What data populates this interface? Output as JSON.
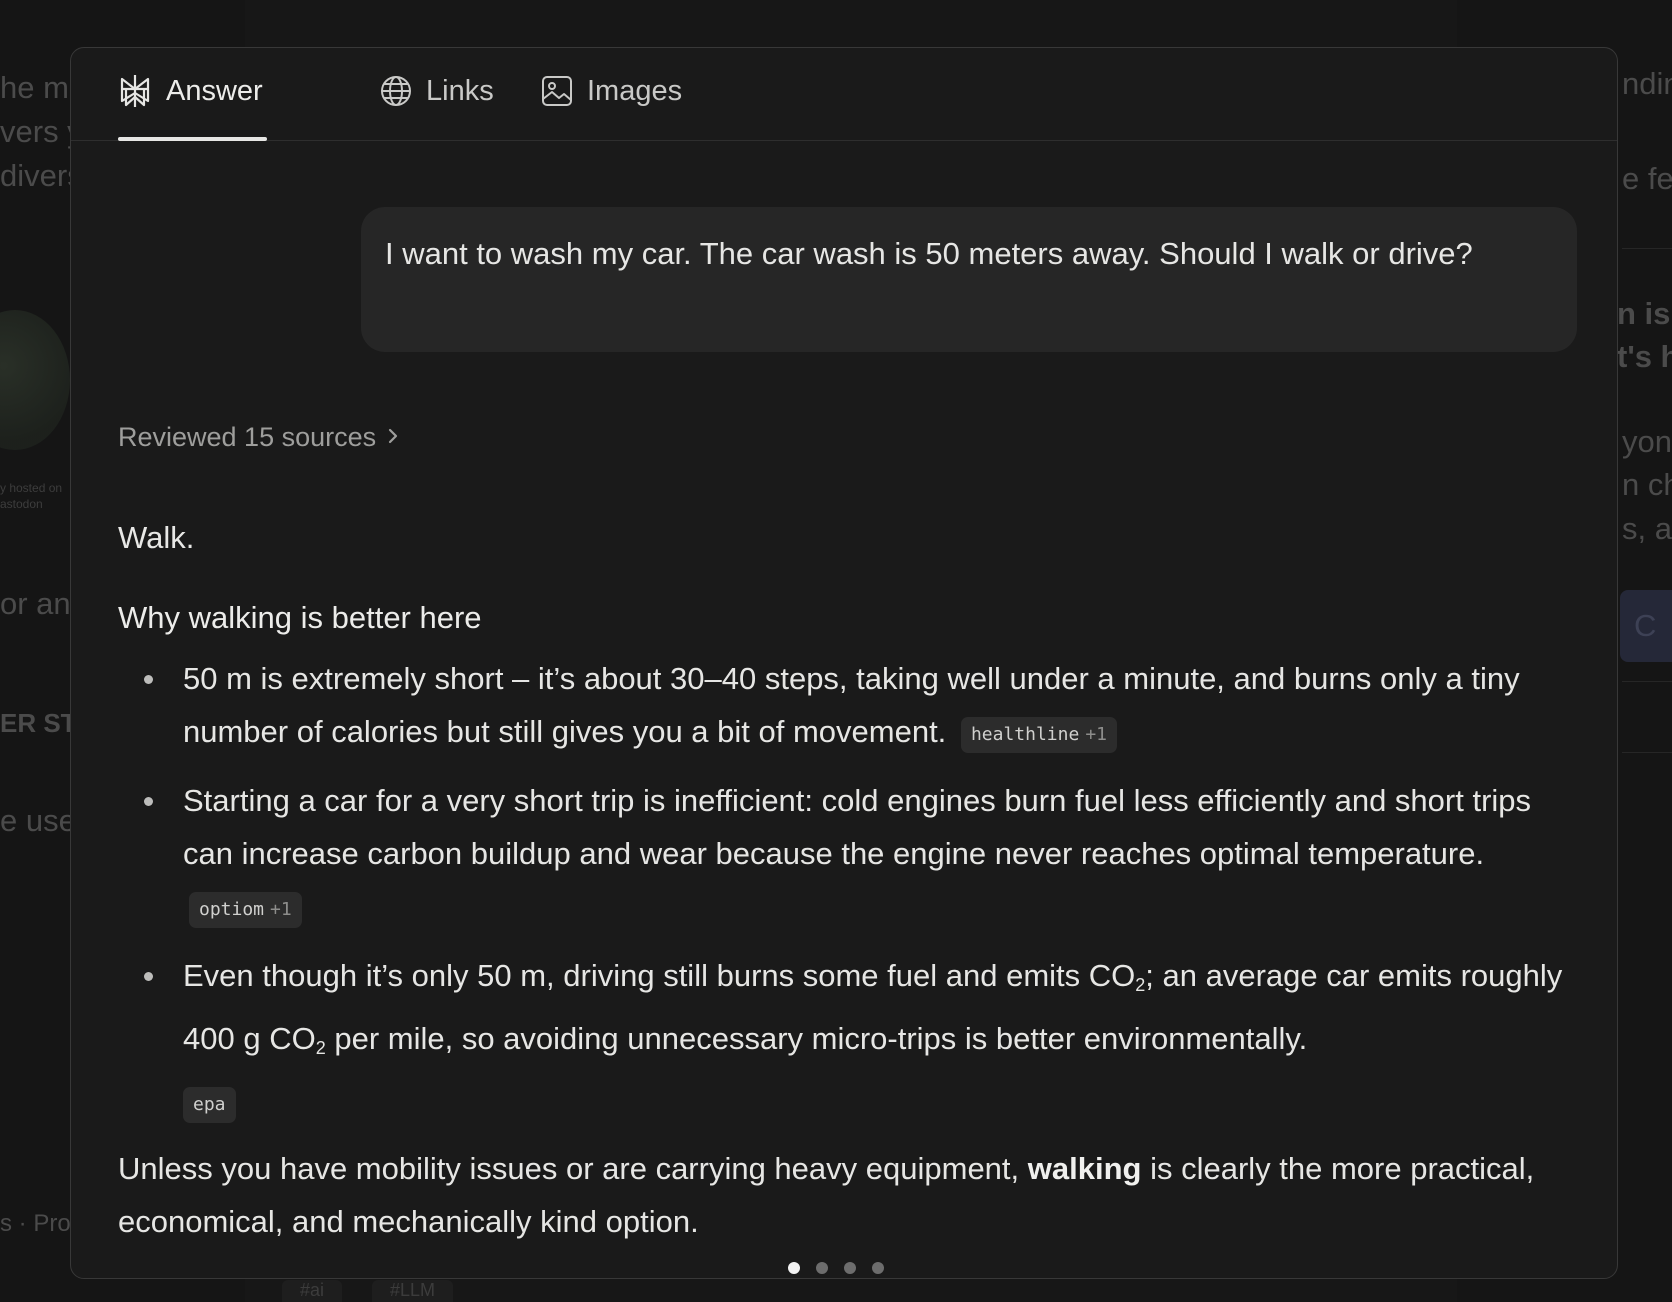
{
  "tabs": [
    {
      "label": "Answer",
      "icon": "perplexity-logo-icon",
      "active": true
    },
    {
      "label": "Links",
      "icon": "globe-icon",
      "active": false
    },
    {
      "label": "Images",
      "icon": "image-icon",
      "active": false
    }
  ],
  "query": {
    "text": "I want to wash my car. The car wash is 50 meters away. Should I walk or drive?"
  },
  "sources": {
    "label": "Reviewed 15 sources",
    "icon": "chevron-right-icon"
  },
  "answer": {
    "verdict": "Walk.",
    "heading": "Why walking is better here",
    "points": [
      {
        "text": "50 m is extremely short – it’s about 30–40 steps, taking well under a minute, and burns only a tiny number of calories but still gives you a bit of movement.",
        "citation": {
          "source": "healthline",
          "extra": "+1"
        }
      },
      {
        "text": "Starting a car for a very short trip is inefficient: cold engines burn fuel less efficiently and short trips can increase carbon buildup and wear because the engine never reaches optimal temperature.",
        "citation": {
          "source": "optiom",
          "extra": "+1"
        }
      },
      {
        "text_a": "Even though it’s only 50 m, driving still burns some fuel and emits CO",
        "sub_a": "2",
        "text_b": "; an average car emits roughly 400 g CO",
        "sub_b": "2",
        "text_c": " per mile, so avoiding unnecessary micro-trips is better environmentally.",
        "citation": {
          "source": "epa"
        }
      }
    ],
    "closing_before": "Unless you have mobility issues or are carrying heavy equipment, ",
    "closing_bold": "walking",
    "closing_after": " is clearly the more practical, economical, and mechanically kind option."
  },
  "pager": {
    "count": 4,
    "active_index": 0
  },
  "background": {
    "left_fragments": [
      "he m",
      "vers y",
      "divers",
      "or any",
      "ER ST",
      "e user",
      "s · Pro"
    ],
    "left_small": [
      "y hosted on",
      "astodon"
    ],
    "right_fragments": [
      "ndin",
      "e fee",
      "n is t",
      "t's ha",
      "yon",
      "n ch",
      "s, a",
      "C"
    ],
    "bottom_tags": [
      "#ai",
      "#LLM"
    ]
  }
}
